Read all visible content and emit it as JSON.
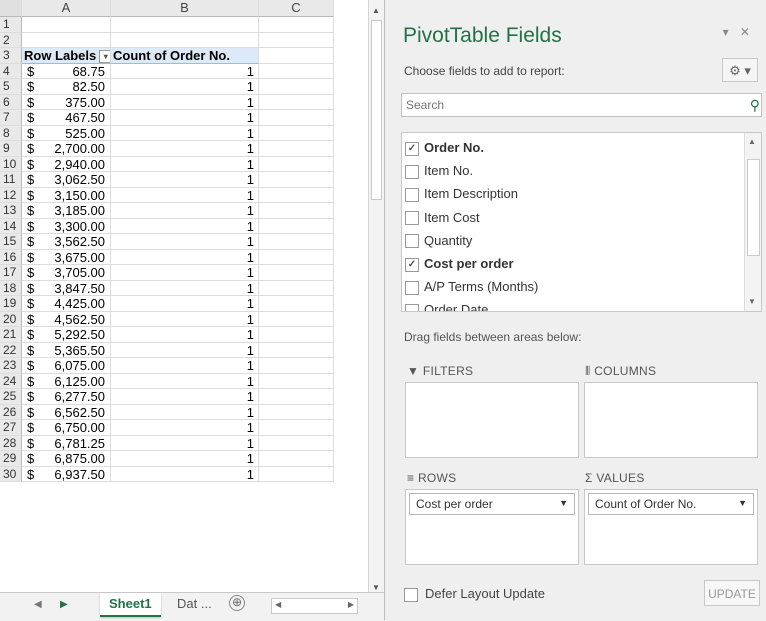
{
  "columns": [
    "A",
    "B",
    "C"
  ],
  "row_numbers": [
    "1",
    "2",
    "3",
    "4",
    "5",
    "6",
    "7",
    "8",
    "9",
    "10",
    "11",
    "12",
    "13",
    "14",
    "15",
    "16",
    "17",
    "18",
    "19",
    "20",
    "21",
    "22",
    "23",
    "24",
    "25",
    "26",
    "27",
    "28",
    "29",
    "30"
  ],
  "pivot": {
    "row_labels_header": "Row Labels",
    "count_header": "Count of Order No.",
    "currency_symbol": "$",
    "rows": [
      {
        "amount": "68.75",
        "count": "1"
      },
      {
        "amount": "82.50",
        "count": "1"
      },
      {
        "amount": "375.00",
        "count": "1"
      },
      {
        "amount": "467.50",
        "count": "1"
      },
      {
        "amount": "525.00",
        "count": "1"
      },
      {
        "amount": "2,700.00",
        "count": "1"
      },
      {
        "amount": "2,940.00",
        "count": "1"
      },
      {
        "amount": "3,062.50",
        "count": "1"
      },
      {
        "amount": "3,150.00",
        "count": "1"
      },
      {
        "amount": "3,185.00",
        "count": "1"
      },
      {
        "amount": "3,300.00",
        "count": "1"
      },
      {
        "amount": "3,562.50",
        "count": "1"
      },
      {
        "amount": "3,675.00",
        "count": "1"
      },
      {
        "amount": "3,705.00",
        "count": "1"
      },
      {
        "amount": "3,847.50",
        "count": "1"
      },
      {
        "amount": "4,425.00",
        "count": "1"
      },
      {
        "amount": "4,562.50",
        "count": "1"
      },
      {
        "amount": "5,292.50",
        "count": "1"
      },
      {
        "amount": "5,365.50",
        "count": "1"
      },
      {
        "amount": "6,075.00",
        "count": "1"
      },
      {
        "amount": "6,125.00",
        "count": "1"
      },
      {
        "amount": "6,277.50",
        "count": "1"
      },
      {
        "amount": "6,562.50",
        "count": "1"
      },
      {
        "amount": "6,750.00",
        "count": "1"
      },
      {
        "amount": "6,781.25",
        "count": "1"
      },
      {
        "amount": "6,875.00",
        "count": "1"
      },
      {
        "amount": "6,937.50",
        "count": "1"
      }
    ]
  },
  "sheet_tabs": {
    "active": "Sheet1",
    "second": "Dat ...",
    "add": "⊕"
  },
  "panel": {
    "title": "PivotTable Fields",
    "window_controls": "▾ ✕",
    "choose_label": "Choose fields to add to report:",
    "gear_glyph": "⚙ ▾",
    "search_placeholder": "Search",
    "search_icon": "magnifier-icon",
    "fields": [
      {
        "label": "Order No.",
        "checked": true
      },
      {
        "label": "Item No.",
        "checked": false
      },
      {
        "label": "Item Description",
        "checked": false
      },
      {
        "label": "Item Cost",
        "checked": false
      },
      {
        "label": "Quantity",
        "checked": false
      },
      {
        "label": "Cost per order",
        "checked": true
      },
      {
        "label": "A/P Terms (Months)",
        "checked": false
      },
      {
        "label": "Order Date",
        "checked": false
      }
    ],
    "drag_label": "Drag fields between areas below:",
    "filters_label": "FILTERS",
    "columns_label": "COLUMNS",
    "rows_label": "ROWS",
    "values_label": "VALUES",
    "rows_chip": "Cost per order",
    "values_chip": "Count of Order No.",
    "defer_label": "Defer Layout Update",
    "update_label": "UPDATE"
  },
  "colors": {
    "accent": "#217346",
    "header_fill": "#dde9f6"
  }
}
